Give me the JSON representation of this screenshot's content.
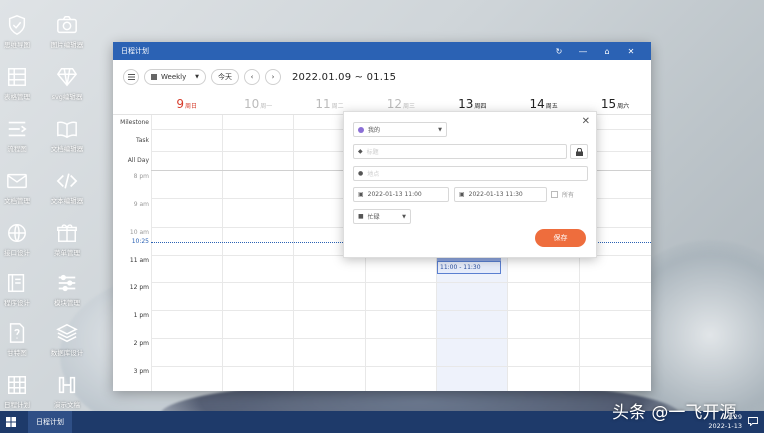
{
  "desktop": {
    "icons": [
      {
        "label": "思维导图",
        "icon": "shield-check-icon"
      },
      {
        "label": "图片编辑器",
        "icon": "camera-icon"
      },
      {
        "label": "表格管理",
        "icon": "spreadsheet-icon"
      },
      {
        "label": "svg编辑器",
        "icon": "diamond-icon"
      },
      {
        "label": "流程图",
        "icon": "flow-list-icon"
      },
      {
        "label": "文档编辑器",
        "icon": "open-book-icon"
      },
      {
        "label": "文档管理",
        "icon": "envelope-icon"
      },
      {
        "label": "文本编辑器",
        "icon": "code-brackets-icon"
      },
      {
        "label": "接口设计",
        "icon": "globe-icon"
      },
      {
        "label": "菜单管理",
        "icon": "gift-icon"
      },
      {
        "label": "程序设计",
        "icon": "book-page-icon"
      },
      {
        "label": "模块管理",
        "icon": "sliders-icon"
      },
      {
        "label": "甘特图",
        "icon": "question-doc-icon"
      },
      {
        "label": "数据库设计",
        "icon": "layers-icon"
      },
      {
        "label": "日程计划",
        "icon": "calendar-grid-icon"
      },
      {
        "label": "演示文稿",
        "icon": "presentation-icon"
      }
    ]
  },
  "window": {
    "title": "日程计划",
    "toolbar": {
      "menu_icon": "hamburger-icon",
      "view_select": "Weekly",
      "today_label": "今天",
      "prev_icon": "chevron-left-icon",
      "next_icon": "chevron-right-icon",
      "date_range": "2022.01.09 ~ 01.15"
    },
    "days": [
      {
        "num": "9",
        "wk": "周日",
        "kind": "sun"
      },
      {
        "num": "10",
        "wk": "周一",
        "kind": "past"
      },
      {
        "num": "11",
        "wk": "周二",
        "kind": "past"
      },
      {
        "num": "12",
        "wk": "周三",
        "kind": "past"
      },
      {
        "num": "13",
        "wk": "周四",
        "kind": "today"
      },
      {
        "num": "14",
        "wk": "周五",
        "kind": "today"
      },
      {
        "num": "15",
        "wk": "周六",
        "kind": "today"
      }
    ],
    "row_labels": [
      "Milestone",
      "Task",
      "All Day"
    ],
    "times": [
      {
        "label": "8 pm",
        "major": false
      },
      {
        "label": "9 am",
        "major": false
      },
      {
        "label": "10 am",
        "major": false
      },
      {
        "label": "11 am",
        "major": true
      },
      {
        "label": "12 pm",
        "major": true
      },
      {
        "label": "1 pm",
        "major": true
      },
      {
        "label": "2 pm",
        "major": true
      },
      {
        "label": "3 pm",
        "major": true
      }
    ],
    "now_time": "10:25",
    "event": {
      "time": "11:00 - 11:30"
    }
  },
  "popup": {
    "calendar": "我的",
    "title_placeholder": "标题",
    "location_placeholder": "地点",
    "start": "2022-01-13 11:00",
    "end": "2022-01-13 11:30",
    "allday_label": "所有",
    "state": "忙碌",
    "save_label": "保存",
    "calendar_color": "#8b6fd6"
  },
  "taskbar": {
    "task_label": "日程计划",
    "time": "11:29",
    "date": "2022-1-13"
  },
  "watermark": "头条 @一飞开源"
}
